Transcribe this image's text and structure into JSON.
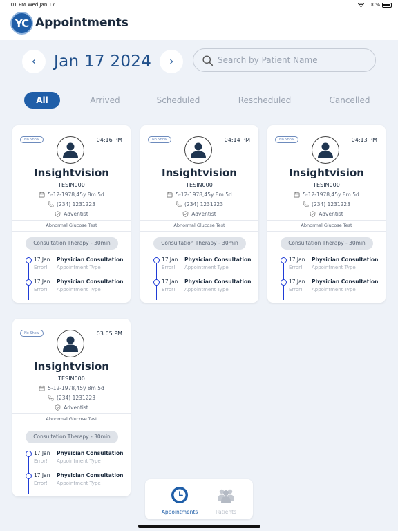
{
  "status_bar": {
    "time": "1:01 PM",
    "date": "Wed Jan 17",
    "battery": "100%"
  },
  "header": {
    "logo_text": "YC",
    "title": "Appointments"
  },
  "date_nav": {
    "prev": "‹",
    "date": "Jan 17 2024",
    "next": "›"
  },
  "search": {
    "placeholder": "Search by Patient Name",
    "value": ""
  },
  "filters": [
    "All",
    "Arrived",
    "Scheduled",
    "Rescheduled",
    "Cancelled"
  ],
  "active_filter": "All",
  "cards": [
    {
      "badge": "No Show",
      "time": "04:16 PM",
      "name": "Insightvision",
      "id": "TESIN000",
      "dob": "5-12-1978,45y 8m 5d",
      "phone": "(234) 1231223",
      "religion": "Adventist",
      "test": "Abnormal Glucose Test",
      "therapy": "Consultation Therapy - 30min",
      "appointments": [
        {
          "date": "17 Jan",
          "title": "Physician Consultation",
          "status": "Error!",
          "type": "Appointment Type"
        },
        {
          "date": "17 Jan",
          "title": "Physician Consultation",
          "status": "Error!",
          "type": "Appointment Type"
        }
      ]
    },
    {
      "badge": "No Show",
      "time": "04:14 PM",
      "name": "Insightvision",
      "id": "TESIN000",
      "dob": "5-12-1978,45y 8m 5d",
      "phone": "(234) 1231223",
      "religion": "Adventist",
      "test": "Abnormal Glucose Test",
      "therapy": "Consultation Therapy - 30min",
      "appointments": [
        {
          "date": "17 Jan",
          "title": "Physician Consultation",
          "status": "Error!",
          "type": "Appointment Type"
        },
        {
          "date": "17 Jan",
          "title": "Physician Consultation",
          "status": "Error!",
          "type": "Appointment Type"
        }
      ]
    },
    {
      "badge": "No Show",
      "time": "04:13 PM",
      "name": "Insightvision",
      "id": "TESIN000",
      "dob": "5-12-1978,45y 8m 5d",
      "phone": "(234) 1231223",
      "religion": "Adventist",
      "test": "Abnormal Glucose Test",
      "therapy": "Consultation Therapy - 30min",
      "appointments": [
        {
          "date": "17 Jan",
          "title": "Physician Consultation",
          "status": "Error!",
          "type": "Appointment Type"
        },
        {
          "date": "17 Jan",
          "title": "Physician Consultation",
          "status": "Error!",
          "type": "Appointment Type"
        }
      ]
    },
    {
      "badge": "No Show",
      "time": "03:05 PM",
      "name": "Insightvision",
      "id": "TESIN000",
      "dob": "5-12-1978,45y 8m 5d",
      "phone": "(234) 1231223",
      "religion": "Adventist",
      "test": "Abnormal Glucose Test",
      "therapy": "Consultation Therapy - 30min",
      "appointments": [
        {
          "date": "17 Jan",
          "title": "Physician Consultation",
          "status": "Error!",
          "type": "Appointment Type"
        },
        {
          "date": "17 Jan",
          "title": "Physician Consultation",
          "status": "Error!",
          "type": "Appointment Type"
        }
      ]
    }
  ],
  "bottom_nav": [
    {
      "label": "Appointments",
      "icon": "clock-icon",
      "active": true
    },
    {
      "label": "Patients",
      "icon": "users-icon",
      "active": false
    }
  ],
  "colors": {
    "accent": "#1f5ea8",
    "background": "#eef2f8",
    "timeline": "#1f3cd6",
    "muted": "#a9b0bb"
  }
}
